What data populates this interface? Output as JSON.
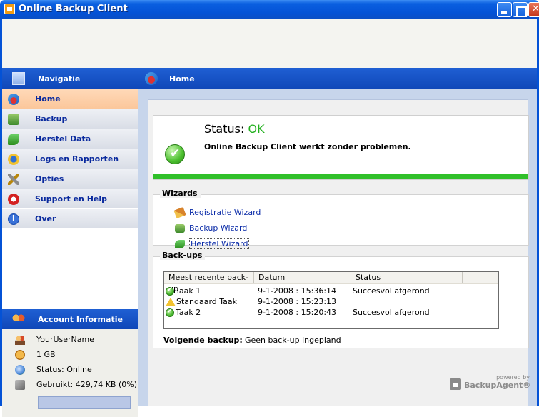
{
  "window": {
    "title": "Online Backup Client"
  },
  "sidebar": {
    "header": "Navigatie",
    "items": [
      {
        "label": "Home",
        "icon": "home-icon",
        "active": true
      },
      {
        "label": "Backup",
        "icon": "backup-icon"
      },
      {
        "label": "Herstel Data",
        "icon": "restore-icon"
      },
      {
        "label": "Logs en Rapporten",
        "icon": "logs-icon"
      },
      {
        "label": "Opties",
        "icon": "options-icon"
      },
      {
        "label": "Support en Help",
        "icon": "support-icon"
      },
      {
        "label": "Over",
        "icon": "info-icon"
      }
    ],
    "account": {
      "header": "Account Informatie",
      "username": "YourUserName",
      "quota": "1 GB",
      "status": "Status: Online",
      "used": "Gebruikt: 429,74 KB (0%)",
      "used_fraction": 0.0
    }
  },
  "main": {
    "header": "Home",
    "status": {
      "label": "Status:",
      "value": "OK",
      "message": "Online Backup Client werkt zonder problemen.",
      "color": "#22b01e"
    },
    "wizards": {
      "title": "Wizards",
      "items": [
        "Registratie Wizard",
        "Backup Wizard",
        "Herstel Wizard"
      ]
    },
    "backups": {
      "title": "Back-ups",
      "columns": [
        "Meest recente back-up",
        "Datum",
        "Status"
      ],
      "rows": [
        {
          "icon": "ok-icon",
          "name": "Taak 1",
          "date": "9-1-2008 : 15:36:14",
          "status": "Succesvol afgerond"
        },
        {
          "icon": "warning-icon",
          "name": "Standaard Taak",
          "date": "9-1-2008 : 15:23:13",
          "status": ""
        },
        {
          "icon": "ok-icon",
          "name": "Taak 2",
          "date": "9-1-2008 : 15:20:43",
          "status": "Succesvol afgerond"
        }
      ],
      "next_label": "Volgende backup:",
      "next_value": "Geen back-up ingepland"
    },
    "powered": {
      "small": "powered by",
      "brand": "BackupAgent®"
    }
  }
}
